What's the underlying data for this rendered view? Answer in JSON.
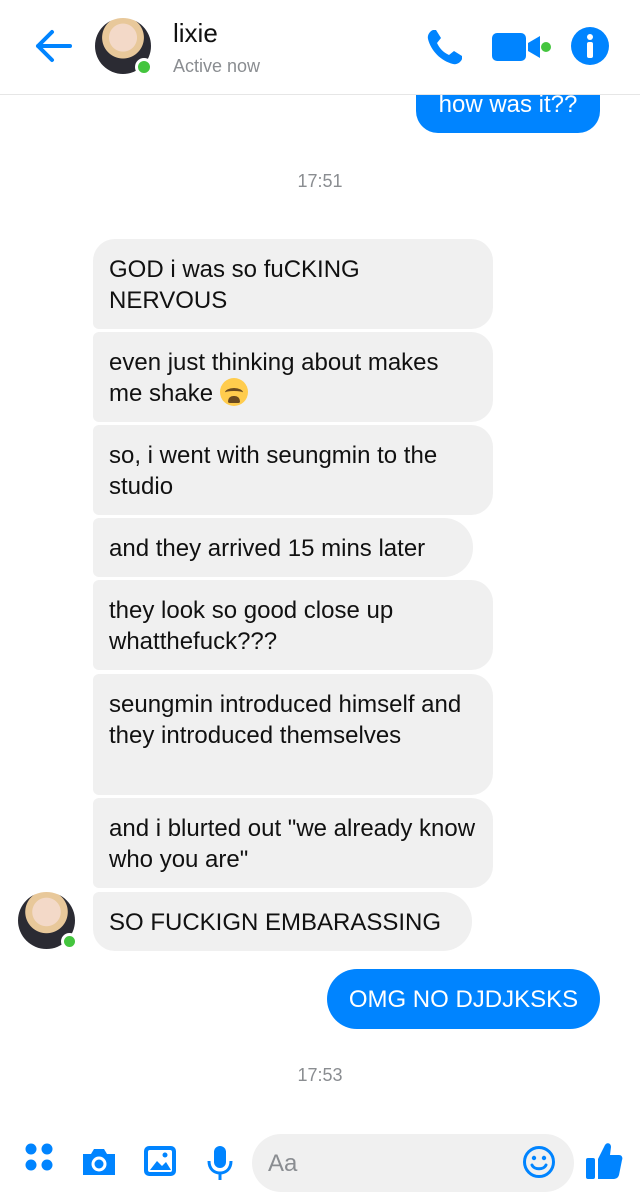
{
  "header": {
    "contact_name": "lixie",
    "status": "Active now"
  },
  "colors": {
    "accent": "#0084ff",
    "incoming_bubble": "#f0f0f0",
    "presence": "#44c53e",
    "muted_text": "#8a8d91"
  },
  "icons": [
    "back-arrow-icon",
    "phone-icon",
    "video-camera-icon",
    "info-icon",
    "more-dots-icon",
    "camera-icon",
    "gallery-icon",
    "microphone-icon",
    "emoji-icon",
    "thumbs-up-icon",
    "crying-emoji"
  ],
  "messages": {
    "out_top": "how was it??",
    "time_1": "17:51",
    "in": [
      "GOD i was so fuCKING NERVOUS",
      "even just thinking about makes me shake",
      "so, i went with seungmin to the studio",
      "and they arrived 15 mins later",
      "they look so good close up whatthefuck???",
      "seungmin introduced himself and they introduced themselves",
      "and i blurted out \"we already know who you are\"",
      "SO FUCKIGN EMBARASSING"
    ],
    "out_bottom": "OMG NO DJDJKSKS",
    "time_2": "17:53"
  },
  "composer": {
    "placeholder": "Aa"
  }
}
